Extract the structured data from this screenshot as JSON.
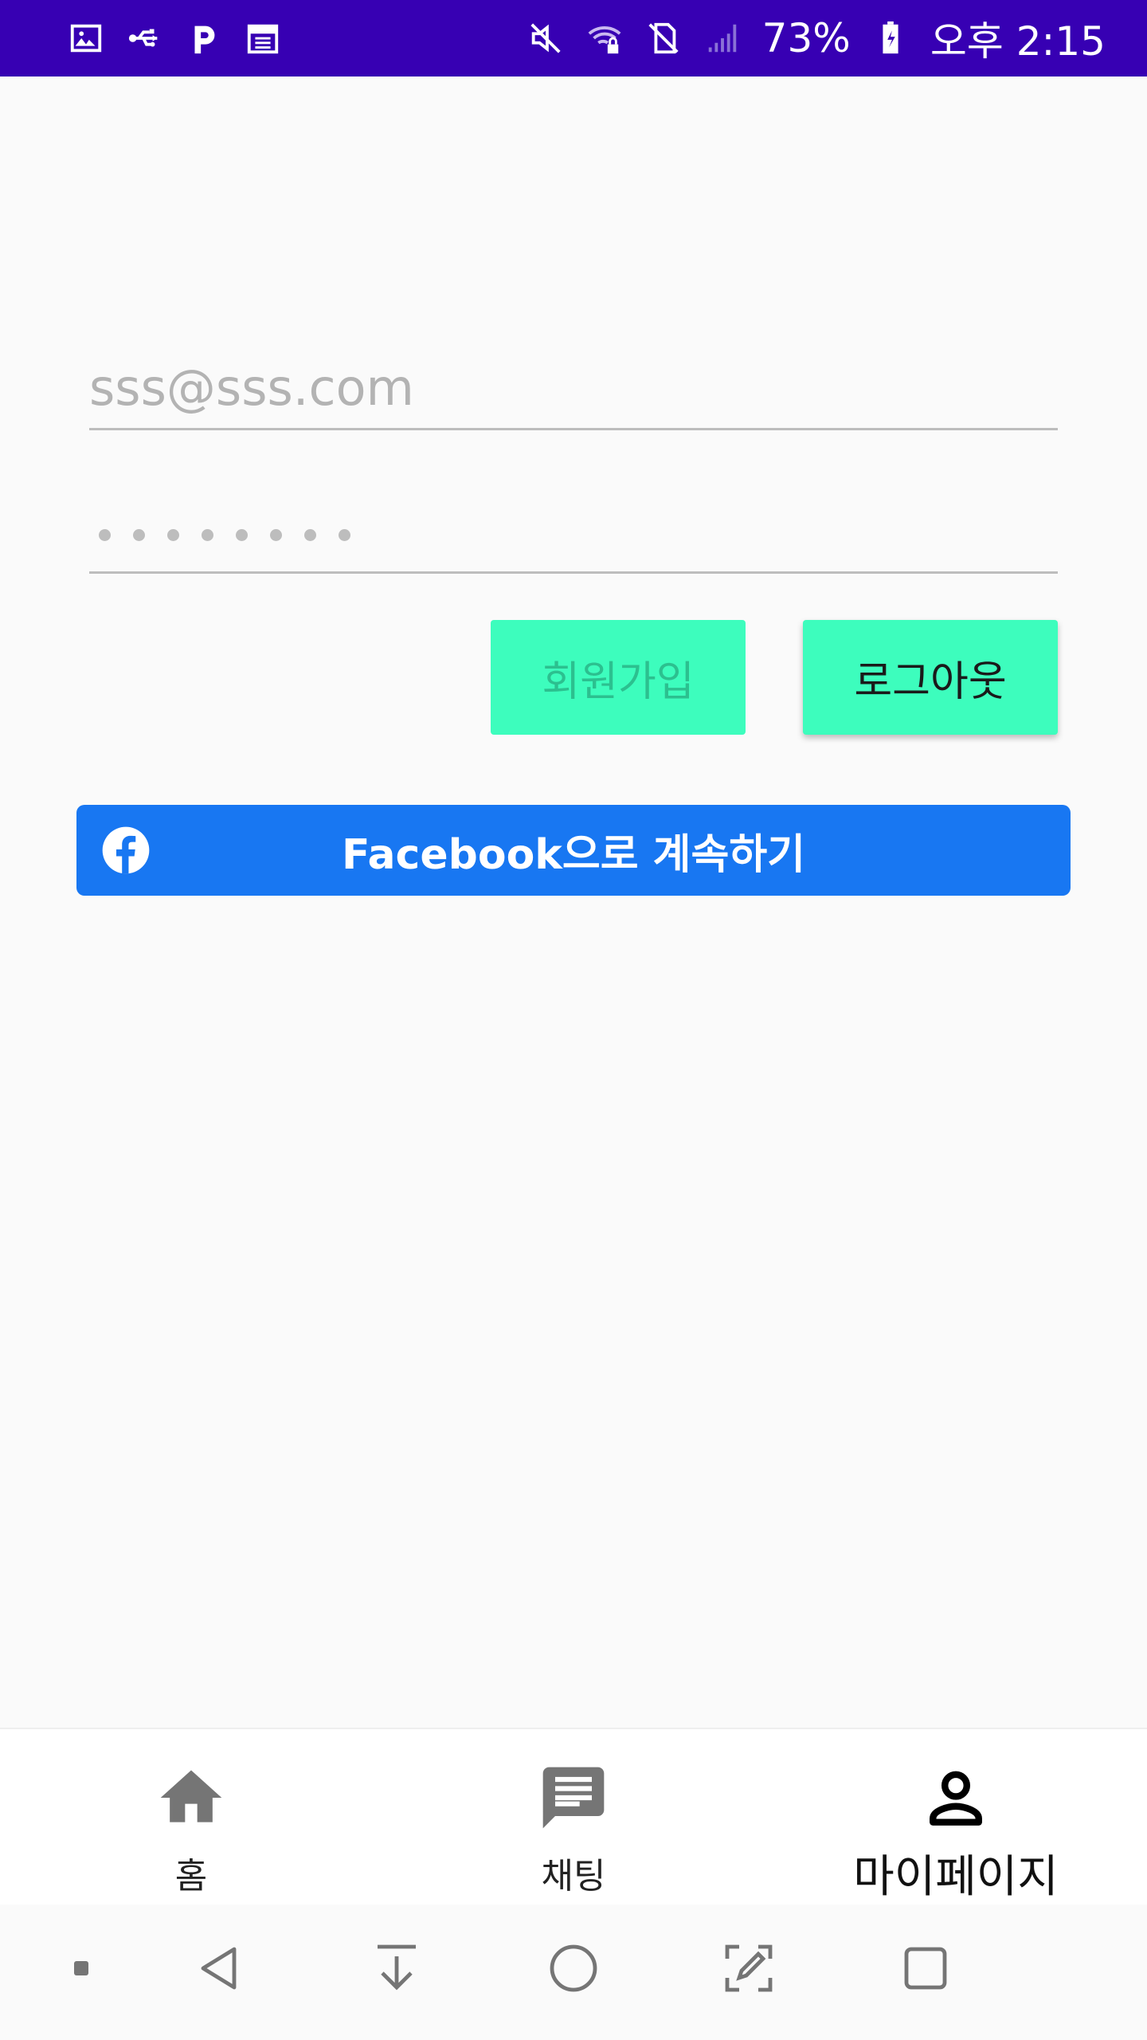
{
  "status_bar": {
    "battery": "73%",
    "time": "오후 2:15",
    "icons_left": [
      "gallery-icon",
      "usb-icon",
      "p-app-icon",
      "calendar-icon"
    ],
    "icons_right": [
      "mute-icon",
      "wifi-lock-icon",
      "no-sim-icon",
      "signal-icon",
      "battery-charging-icon"
    ]
  },
  "login_form": {
    "email_value": "sss@sss.com",
    "password_mask": "••••••••",
    "signup_label": "회원가입",
    "logout_label": "로그아웃",
    "facebook_label": "Facebook으로 계속하기"
  },
  "bottom_nav": {
    "items": [
      {
        "label": "홈",
        "icon": "home-icon"
      },
      {
        "label": "채팅",
        "icon": "chat-icon"
      },
      {
        "label": "마이페이지",
        "icon": "person-icon"
      }
    ],
    "active": "마이페이지"
  },
  "system_nav": {
    "buttons": [
      "dot-icon",
      "back-icon",
      "download-icon",
      "home-circle-icon",
      "edit-screenshot-icon",
      "recents-icon"
    ]
  },
  "colors": {
    "status_bar": "#3700b3",
    "accent_green": "#3dfdbd",
    "facebook_blue": "#1877f2",
    "background": "#fafafa"
  }
}
